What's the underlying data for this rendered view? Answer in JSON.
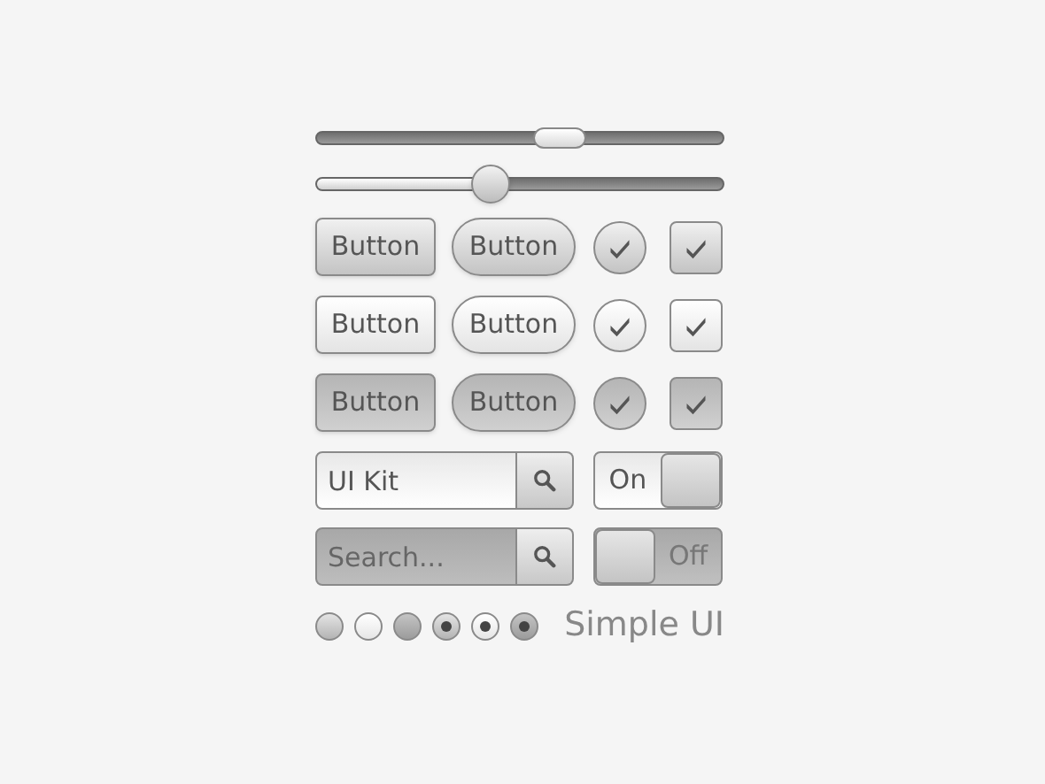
{
  "sliders": [
    {
      "kind": "pill",
      "level": 0.6
    },
    {
      "kind": "round",
      "level": 0.43
    }
  ],
  "button_rows": [
    {
      "kind": "normal",
      "buttons": [
        "Button",
        "Button"
      ],
      "round_check": {
        "checked": true
      },
      "square_check": {
        "checked": true
      }
    },
    {
      "kind": "light",
      "buttons": [
        "Button",
        "Button"
      ],
      "round_check": {
        "checked": true
      },
      "square_check": {
        "checked": true
      }
    },
    {
      "kind": "pressed",
      "buttons": [
        "Button",
        "Button"
      ],
      "round_check": {
        "checked": true
      },
      "square_check": {
        "checked": true
      }
    }
  ],
  "form_rows": [
    {
      "kind": "light",
      "search": {
        "value": "UI Kit"
      },
      "toggle": {
        "label": "On",
        "on": true
      }
    },
    {
      "kind": "dark",
      "search": {
        "placeholder": "Search..."
      },
      "toggle": {
        "label": "Off",
        "on": false
      }
    }
  ],
  "radios": [
    {
      "kind": "gray",
      "selected": false
    },
    {
      "kind": "white",
      "selected": false
    },
    {
      "kind": "dark",
      "selected": false
    },
    {
      "kind": "gray",
      "selected": true
    },
    {
      "kind": "white",
      "selected": true
    },
    {
      "kind": "dark",
      "selected": true
    }
  ],
  "caption": "Simple UI"
}
